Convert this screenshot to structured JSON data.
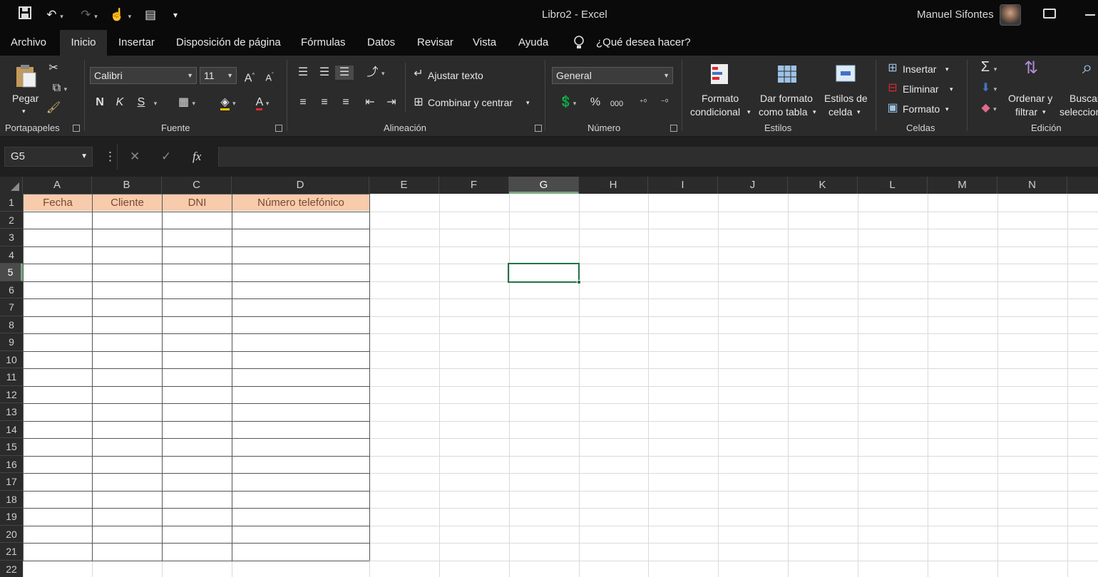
{
  "app": {
    "title": "Libro2  -  Excel",
    "user": "Manuel Sifontes"
  },
  "tabs": [
    "Archivo",
    "Inicio",
    "Insertar",
    "Disposición de página",
    "Fórmulas",
    "Datos",
    "Revisar",
    "Vista",
    "Ayuda"
  ],
  "tell_me": "¿Qué desea hacer?",
  "ribbon": {
    "clipboard": {
      "paste": "Pegar",
      "label": "Portapapeles"
    },
    "font": {
      "name": "Calibri",
      "size": "11",
      "bold": "N",
      "italic": "K",
      "underline": "S",
      "label": "Fuente"
    },
    "alignment": {
      "wrap": "Ajustar texto",
      "merge": "Combinar y centrar",
      "label": "Alineación"
    },
    "number": {
      "format": "General",
      "percent": "%",
      "thousands": "000",
      "label": "Número"
    },
    "styles": {
      "conditional_1": "Formato",
      "conditional_2": "condicional",
      "table_1": "Dar formato",
      "table_2": "como tabla",
      "cell_1": "Estilos de",
      "cell_2": "celda",
      "label": "Estilos"
    },
    "cells": {
      "insert": "Insertar",
      "delete": "Eliminar",
      "format": "Formato",
      "label": "Celdas"
    },
    "editing": {
      "sort_1": "Ordenar y",
      "sort_2": "filtrar",
      "find_1": "Buscar y",
      "find_2": "seleccionar",
      "label": "Edición"
    }
  },
  "formula_bar": {
    "namebox": "G5",
    "fx": "fx",
    "value": ""
  },
  "sheet": {
    "columns": [
      "A",
      "B",
      "C",
      "D",
      "E",
      "F",
      "G",
      "H",
      "I",
      "J",
      "K",
      "L",
      "M",
      "N"
    ],
    "rows": [
      "1",
      "2",
      "3",
      "4",
      "5",
      "6",
      "7",
      "8",
      "9",
      "10",
      "11",
      "12",
      "13",
      "14",
      "15",
      "16",
      "17",
      "18",
      "19",
      "20",
      "21",
      "22"
    ],
    "header_row": [
      "Fecha",
      "Cliente",
      "DNI",
      "Número telefónico"
    ],
    "selected_cell": "G5",
    "header_fill": "#f8cbad",
    "accent": "#217346"
  }
}
